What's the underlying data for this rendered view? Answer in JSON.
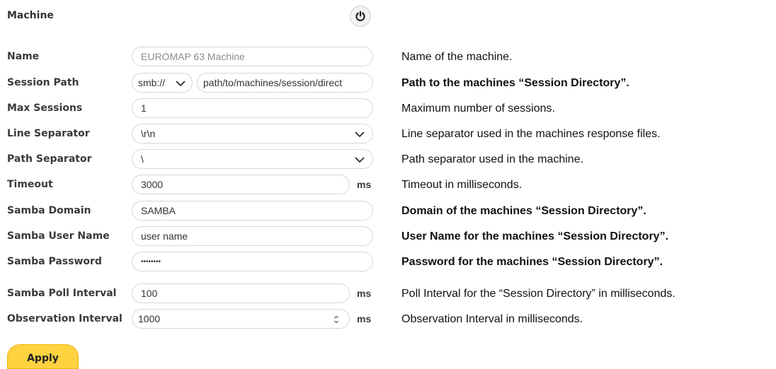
{
  "header": {
    "title": "Machine",
    "power_icon": "power-icon"
  },
  "fields": {
    "name": {
      "label": "Name",
      "value": "EUROMAP 63 Machine",
      "desc": "Name of the machine."
    },
    "session_path": {
      "label": "Session Path",
      "protocol": "smb://",
      "value": "path/to/machines/session/direct",
      "desc": "Path to the machines “Session Directory”."
    },
    "max_sessions": {
      "label": "Max Sessions",
      "value": "1",
      "desc": "Maximum number of sessions."
    },
    "line_separator": {
      "label": "Line Separator",
      "value": "\\r\\n",
      "desc": "Line separator used in the machines response files."
    },
    "path_separator": {
      "label": "Path Separator",
      "value": "\\",
      "desc": "Path separator used in the machine."
    },
    "timeout": {
      "label": "Timeout",
      "value": "3000",
      "unit": "ms",
      "desc": "Timeout in milliseconds."
    },
    "samba_domain": {
      "label": "Samba Domain",
      "value": "SAMBA",
      "desc": "Domain of the machines “Session Directory”."
    },
    "samba_user": {
      "label": "Samba User Name",
      "value": "user name",
      "desc": "User Name for the machines “Session Directory”."
    },
    "samba_password": {
      "label": "Samba Password",
      "value": "••••••••",
      "desc": "Password for the machines “Session Directory”."
    },
    "samba_poll": {
      "label": "Samba Poll Interval",
      "value": "100",
      "unit": "ms",
      "desc": "Poll Interval for the “Session Directory” in milliseconds."
    },
    "observation": {
      "label": "Observation Interval",
      "value": "1000",
      "unit": "ms",
      "desc": "Observation Interval in milliseconds."
    }
  },
  "actions": {
    "apply_label": "Apply"
  }
}
